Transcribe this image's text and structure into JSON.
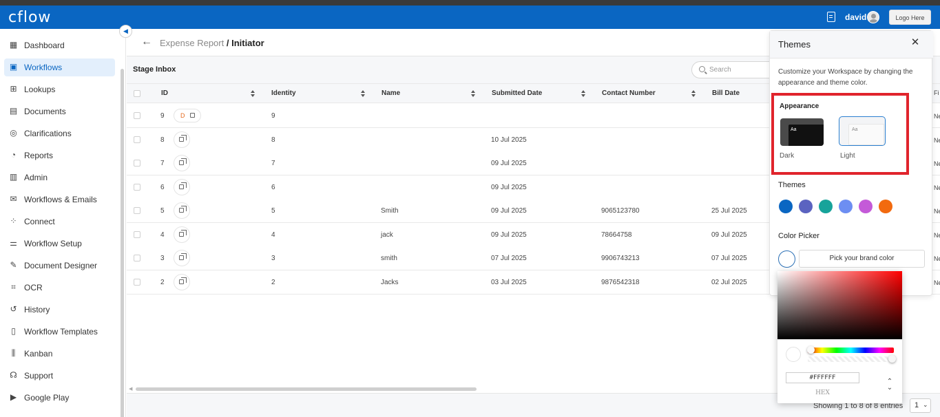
{
  "app": {
    "logo": "cflow",
    "user": "david",
    "logo_button": "Logo Here"
  },
  "sidebar": {
    "items": [
      {
        "label": "Dashboard",
        "icon": "dashboard-icon",
        "glyph": "▦"
      },
      {
        "label": "Workflows",
        "icon": "workflows-icon",
        "glyph": "▣",
        "active": true
      },
      {
        "label": "Lookups",
        "icon": "lookups-icon",
        "glyph": "⊞"
      },
      {
        "label": "Documents",
        "icon": "documents-icon",
        "glyph": "▤"
      },
      {
        "label": "Clarifications",
        "icon": "clarifications-icon",
        "glyph": "◎"
      },
      {
        "label": "Reports",
        "icon": "reports-icon",
        "glyph": "◔"
      },
      {
        "label": "Admin",
        "icon": "admin-icon",
        "glyph": "▥"
      },
      {
        "label": "Workflows & Emails",
        "icon": "mail-icon",
        "glyph": "✉"
      },
      {
        "label": "Connect",
        "icon": "connect-icon",
        "glyph": "⁘"
      },
      {
        "label": "Workflow Setup",
        "icon": "setup-icon",
        "glyph": "⚌"
      },
      {
        "label": "Document Designer",
        "icon": "designer-icon",
        "glyph": "✎"
      },
      {
        "label": "OCR",
        "icon": "ocr-icon",
        "glyph": "⌗"
      },
      {
        "label": "History",
        "icon": "history-icon",
        "glyph": "↺"
      },
      {
        "label": "Workflow Templates",
        "icon": "templates-icon",
        "glyph": "▯"
      },
      {
        "label": "Kanban",
        "icon": "kanban-icon",
        "glyph": "⫼"
      },
      {
        "label": "Support",
        "icon": "support-icon",
        "glyph": "☊"
      },
      {
        "label": "Google Play",
        "icon": "google-play-icon",
        "glyph": "▶"
      }
    ]
  },
  "breadcrumb": {
    "parent": "Expense Report",
    "separator": " / ",
    "current": "Initiator"
  },
  "inbox": {
    "title": "Stage Inbox",
    "search_placeholder": "Search"
  },
  "table": {
    "columns": [
      "ID",
      "Identity",
      "Name",
      "Submitted Date",
      "Contact Number",
      "Bill Date"
    ],
    "rows": [
      {
        "id": "9",
        "draft": "D",
        "identity": "9",
        "name": "",
        "submitted": "",
        "contact": "",
        "bill": ""
      },
      {
        "id": "8",
        "identity": "8",
        "name": "",
        "submitted": "10 Jul 2025",
        "contact": "",
        "bill": ""
      },
      {
        "id": "7",
        "identity": "7",
        "name": "",
        "submitted": "09 Jul 2025",
        "contact": "",
        "bill": ""
      },
      {
        "id": "6",
        "identity": "6",
        "name": "",
        "submitted": "09 Jul 2025",
        "contact": "",
        "bill": ""
      },
      {
        "id": "5",
        "identity": "5",
        "name": "Smith",
        "submitted": "09 Jul 2025",
        "contact": "9065123780",
        "bill": "25 Jul 2025"
      },
      {
        "id": "4",
        "identity": "4",
        "name": "jack",
        "submitted": "09 Jul 2025",
        "contact": "78664758",
        "bill": "09 Jul 2025"
      },
      {
        "id": "3",
        "identity": "3",
        "name": "smith",
        "submitted": "07 Jul 2025",
        "contact": "9906743213",
        "bill": "07 Jul 2025"
      },
      {
        "id": "2",
        "identity": "2",
        "name": "Jacks",
        "submitted": "03 Jul 2025",
        "contact": "9876542318",
        "bill": "02 Jul 2025"
      }
    ],
    "overflow_header": "Fi",
    "overflow_cell": "Ne"
  },
  "footer": {
    "showing": "Showing 1 to 8 of 8 entries",
    "page": "1"
  },
  "themes_panel": {
    "title": "Themes",
    "description": "Customize your Workspace by changing the appearance and theme color.",
    "appearance_label": "Appearance",
    "dark_label": "Dark",
    "light_label": "Light",
    "preview_text": "Aa",
    "themes_label": "Themes",
    "swatches": [
      "#0a66c2",
      "#5b63c0",
      "#17a39a",
      "#6d8ef2",
      "#c45ad8",
      "#f26a0f"
    ],
    "color_picker_label": "Color Picker",
    "pick_button": "Pick your brand color"
  },
  "color_picker": {
    "hex_value": "#FFFFFF",
    "hex_label": "HEX",
    "hue": "#ff0000"
  }
}
